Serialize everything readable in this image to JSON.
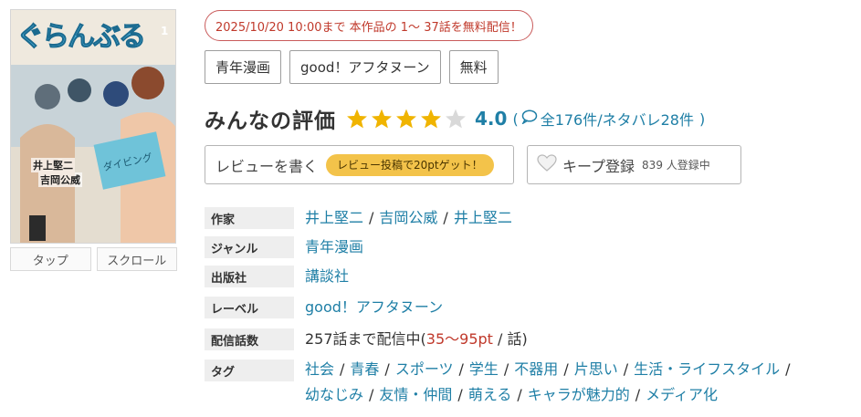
{
  "cover": {
    "title": "ぐらんぶる",
    "volume": "1",
    "author_line1": "井上堅二",
    "author_line2": "吉岡公威"
  },
  "cover_buttons": {
    "tap": "タップ",
    "scroll": "スクロール"
  },
  "campaign": "2025/10/20 10:00まで 本作品の 1〜 37話を無料配信！",
  "tag_buttons": [
    "青年漫画",
    "good！アフタヌーン",
    "無料"
  ],
  "rating": {
    "title": "みんなの評価",
    "stars": 4,
    "max_stars": 5,
    "score": "4.0",
    "open_paren": "(",
    "count": "全176件",
    "spoiler": "/ネタバレ28件",
    "close_paren": ")"
  },
  "actions": {
    "write_review": "レビューを書く",
    "review_bonus": "レビュー投稿で20ptゲット！",
    "keep": "キープ登録",
    "keep_count": "839 人登録中"
  },
  "info": {
    "author": {
      "label": "作家",
      "values": [
        "井上堅二",
        "吉岡公威",
        "井上堅二"
      ]
    },
    "genre": {
      "label": "ジャンル",
      "value": "青年漫画"
    },
    "publisher": {
      "label": "出版社",
      "value": "講談社"
    },
    "label": {
      "label": "レーベル",
      "value": "good！アフタヌーン"
    },
    "episodes": {
      "label": "配信話数",
      "prefix": "257話まで配信中(",
      "price": "35〜95pt",
      "suffix": " / 話)"
    },
    "tags": {
      "label": "タグ",
      "line1": [
        "社会",
        "青春",
        "スポーツ",
        "学生",
        "不器用",
        "片思い",
        "生活・ライフスタイル"
      ],
      "line2": [
        "幼なじみ",
        "友情・仲間",
        "萌える",
        "キャラが魅力的",
        "メディア化"
      ]
    }
  },
  "colors": {
    "link": "#1f7fa6",
    "campaign_red": "#c0392b",
    "star_gold": "#f0b400",
    "badge_yellow": "#f3c34a"
  }
}
